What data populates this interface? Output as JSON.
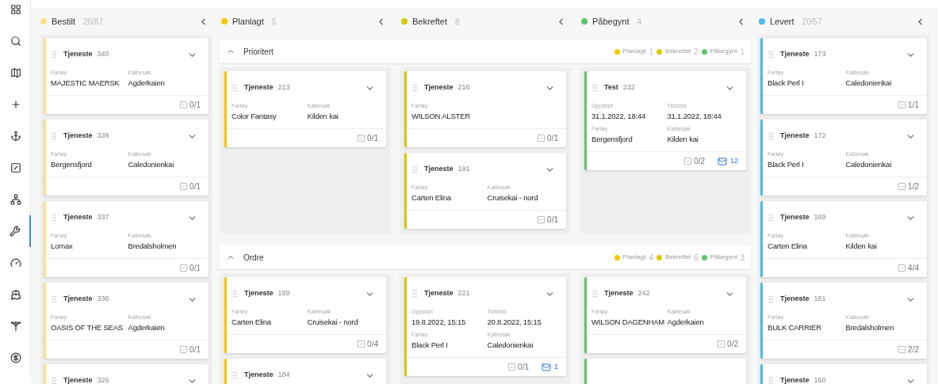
{
  "sidebar": {
    "items": [
      {
        "kind": "grid",
        "selected": false
      },
      {
        "kind": "search",
        "selected": false
      },
      {
        "kind": "map",
        "selected": false
      },
      {
        "kind": "plus",
        "selected": false
      },
      {
        "kind": "anchor",
        "selected": false
      },
      {
        "kind": "image",
        "selected": false
      },
      {
        "kind": "network",
        "selected": false
      },
      {
        "kind": "wrench",
        "selected": true
      },
      {
        "kind": "gauge",
        "selected": false
      },
      {
        "kind": "ship",
        "selected": false
      },
      {
        "kind": "crane",
        "selected": false
      },
      {
        "kind": "dollar",
        "selected": false
      }
    ]
  },
  "columns": [
    {
      "name": "Bestilt",
      "count": "20/87",
      "color": "#fbe08c"
    },
    {
      "name": "Planlagt",
      "count": "5",
      "color": "#f5c800"
    },
    {
      "name": "Bekreftet",
      "count": "8",
      "color": "#d8c800"
    },
    {
      "name": "Påbegynt",
      "count": "4",
      "color": "#62c46c"
    },
    {
      "name": "Levert",
      "count": "20/57",
      "color": "#4cbbe6"
    }
  ],
  "bestilt_cards": [
    {
      "title": "Tjeneste",
      "number": "340",
      "fields": [
        {
          "label": "Fartøy",
          "value": "MAJESTIC MAERSK"
        },
        {
          "label": "Kaibesøk",
          "value": "Agderkaien"
        }
      ],
      "tasks": "0/1"
    },
    {
      "title": "Tjeneste",
      "number": "339",
      "fields": [
        {
          "label": "Fartøy",
          "value": "Bergensfjord"
        },
        {
          "label": "Kaibesøk",
          "value": "Caledonienkai"
        }
      ],
      "tasks": "0/1"
    },
    {
      "title": "Tjeneste",
      "number": "337",
      "fields": [
        {
          "label": "Fartøy",
          "value": "Lomax"
        },
        {
          "label": "Kaibesøk",
          "value": "Bredalsholmen"
        }
      ],
      "tasks": "0/1"
    },
    {
      "title": "Tjeneste",
      "number": "336",
      "fields": [
        {
          "label": "Fartøy",
          "value": "OASIS OF THE SEAS"
        },
        {
          "label": "Kaibesøk",
          "value": "Agderkaien"
        }
      ],
      "tasks": "0/1"
    },
    {
      "title": "Tjeneste",
      "number": "326"
    }
  ],
  "groups": [
    {
      "title": "Prioritert",
      "expanded": true,
      "summary": [
        {
          "label": "Planlagt",
          "count": "1",
          "color": "#f5c800"
        },
        {
          "label": "Bekreftet",
          "count": "2",
          "color": "#d8c800"
        },
        {
          "label": "Påbegynt",
          "count": "1",
          "color": "#62c46c"
        }
      ],
      "lanes": [
        [
          {
            "title": "Tjeneste",
            "number": "213",
            "fields": [
              {
                "label": "Fartøy",
                "value": "Color Fantasy"
              },
              {
                "label": "Kaibesøk",
                "value": "Kilden kai"
              }
            ],
            "tasks": "0/1"
          }
        ],
        [
          {
            "title": "Tjeneste",
            "number": "216",
            "fields": [
              {
                "label": "Fartøy",
                "value": "WILSON ALSTER"
              }
            ],
            "tasks": "0/1"
          },
          {
            "title": "Tjeneste",
            "number": "191",
            "fields": [
              {
                "label": "Fartøy",
                "value": "Carten Elina"
              },
              {
                "label": "Kaibesøk",
                "value": "Cruisekai - nord"
              }
            ],
            "tasks": "0/1"
          }
        ],
        [
          {
            "title": "Test",
            "number": "232",
            "fields": [
              {
                "label": "Oppstart",
                "value": "31.1.2022, 18:44"
              },
              {
                "label": "Tidsfrist",
                "value": "31.1.2022, 18:44"
              },
              {
                "label": "Fartøy",
                "value": "Bergensfjord"
              },
              {
                "label": "Kaibesøk",
                "value": "Kilden kai"
              }
            ],
            "tasks": "0/2",
            "messages": "12"
          }
        ]
      ]
    },
    {
      "title": "Ordre",
      "expanded": true,
      "summary": [
        {
          "label": "Planlagt",
          "count": "4",
          "color": "#f5c800"
        },
        {
          "label": "Bekreftet",
          "count": "6",
          "color": "#d8c800"
        },
        {
          "label": "Påbegynt",
          "count": "3",
          "color": "#62c46c"
        }
      ],
      "lanes": [
        [
          {
            "title": "Tjeneste",
            "number": "189",
            "fields": [
              {
                "label": "Fartøy",
                "value": "Carten Elina"
              },
              {
                "label": "Kaibesøk",
                "value": "Cruisekai - nord"
              }
            ],
            "tasks": "0/4"
          },
          {
            "title": "Tjeneste",
            "number": "184"
          }
        ],
        [
          {
            "title": "Tjeneste",
            "number": "221",
            "fields": [
              {
                "label": "Oppstart",
                "value": "19.8.2022, 15:15"
              },
              {
                "label": "Tidsfrist",
                "value": "20.8.2022, 15:15"
              },
              {
                "label": "Fartøy",
                "value": "Black Perl I"
              },
              {
                "label": "Kaibesøk",
                "value": "Caledonienkai"
              }
            ],
            "tasks": "0/1",
            "messages": "1"
          }
        ],
        [
          {
            "title": "Tjeneste",
            "number": "242",
            "fields": [
              {
                "label": "Fartøy",
                "value": "WILSON DAGENHAM"
              },
              {
                "label": "Kaibesøk",
                "value": "Agderkaien"
              }
            ],
            "tasks": "0/2"
          },
          {
            "kind": "partial"
          }
        ]
      ]
    }
  ],
  "levert_cards": [
    {
      "title": "Tjeneste",
      "number": "173",
      "fields": [
        {
          "label": "Fartøy",
          "value": "Black Perl I"
        },
        {
          "label": "Kaibesøk",
          "value": "Caledonienkai"
        }
      ],
      "tasks": "1/1"
    },
    {
      "title": "Tjeneste",
      "number": "172",
      "fields": [
        {
          "label": "Fartøy",
          "value": "Black Perl I"
        },
        {
          "label": "Kaibesøk",
          "value": "Caledonienkai"
        }
      ],
      "tasks": "1/2"
    },
    {
      "title": "Tjeneste",
      "number": "169",
      "fields": [
        {
          "label": "Fartøy",
          "value": "Carten Elina"
        },
        {
          "label": "Kaibesøk",
          "value": "Kilden kai"
        }
      ],
      "tasks": "4/4"
    },
    {
      "title": "Tjeneste",
      "number": "161",
      "fields": [
        {
          "label": "Fartøy",
          "value": "BULK CARRIER"
        },
        {
          "label": "Kaibesøk",
          "value": "Bredalsholmen"
        }
      ],
      "tasks": "2/2"
    },
    {
      "title": "Tjeneste",
      "number": "160"
    }
  ]
}
